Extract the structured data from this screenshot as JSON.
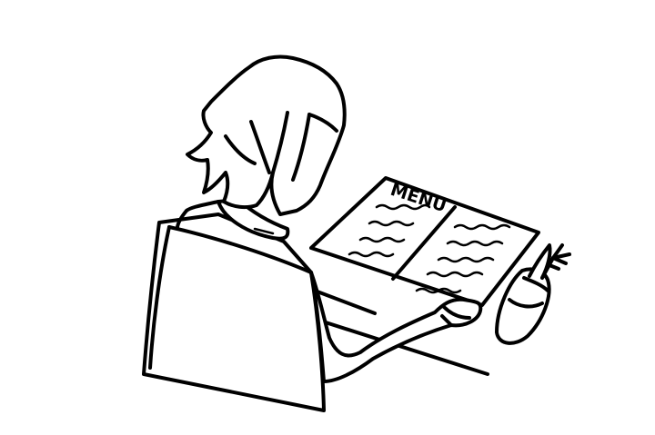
{
  "menu": {
    "title": "MENU"
  },
  "colors": {
    "ink": "#000000",
    "background": "#ffffff"
  }
}
